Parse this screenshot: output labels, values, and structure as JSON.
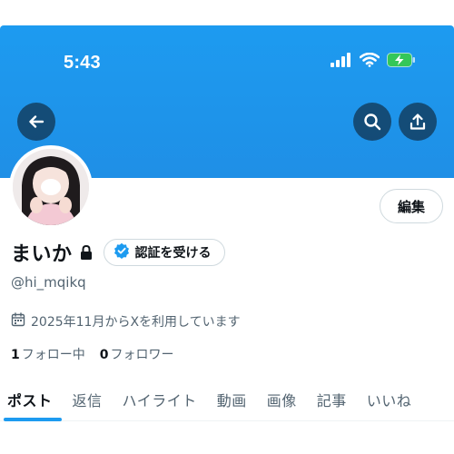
{
  "status_bar": {
    "time": "5:43",
    "icons": [
      "signal-icon",
      "wifi-icon",
      "battery-charging-icon"
    ]
  },
  "header": {
    "back_icon": "arrow-left-icon",
    "search_icon": "search-icon",
    "share_icon": "share-icon",
    "banner_color": "#1d9bf0"
  },
  "profile": {
    "display_name": "まいか",
    "handle": "@hi_mqikq",
    "verify_button_label": "認証を受ける",
    "edit_button_label": "編集",
    "joined_text": "2025年11月からXを利用しています",
    "following_count": "1",
    "following_label": "フォロー中",
    "followers_count": "0",
    "followers_label": "フォロワー"
  },
  "tabs": [
    {
      "label": "ポスト",
      "active": true
    },
    {
      "label": "返信",
      "active": false
    },
    {
      "label": "ハイライト",
      "active": false
    },
    {
      "label": "動画",
      "active": false
    },
    {
      "label": "画像",
      "active": false
    },
    {
      "label": "記事",
      "active": false
    },
    {
      "label": "いいね",
      "active": false
    }
  ],
  "colors": {
    "accent": "#1d9bf0",
    "text_primary": "#0f1419",
    "text_secondary": "#536471",
    "battery": "#34c759"
  }
}
